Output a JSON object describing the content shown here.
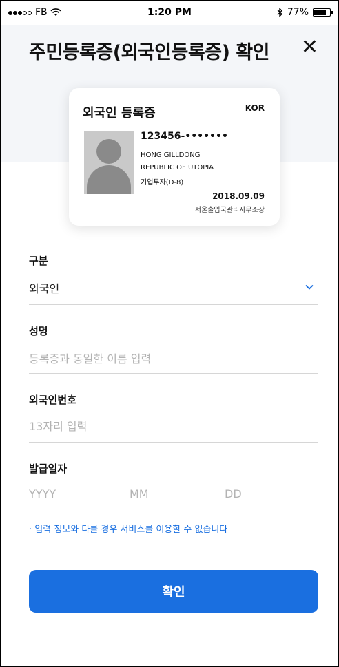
{
  "status_bar": {
    "carrier": "FB",
    "time": "1:20 PM",
    "battery": "77%"
  },
  "header": {
    "title": "주민등록증(외국인등록증) 확인"
  },
  "card": {
    "title": "외국인 등록증",
    "country": "KOR",
    "number": "123456-•••••••",
    "name": "HONG GILLDONG",
    "nation": "REPUBLIC OF UTOPIA",
    "visa": "기업투자(D-8)",
    "issue_date": "2018.09.09",
    "office": "서울출입국관리사무소장"
  },
  "form": {
    "type": {
      "label": "구분",
      "value": "외국인"
    },
    "name": {
      "label": "성명",
      "placeholder": "등록증과 동일한 이름 입력"
    },
    "reg_number": {
      "label": "외국인번호",
      "placeholder": "13자리 입력"
    },
    "issue_date": {
      "label": "발급일자",
      "year": "YYYY",
      "month": "MM",
      "day": "DD"
    },
    "warning": "· 입력 정보와 다를 경우 서비스를 이용할 수 없습니다"
  },
  "confirm_label": "확인",
  "colors": {
    "accent": "#1a6fe0",
    "header_bg": "#f4f6f9"
  }
}
